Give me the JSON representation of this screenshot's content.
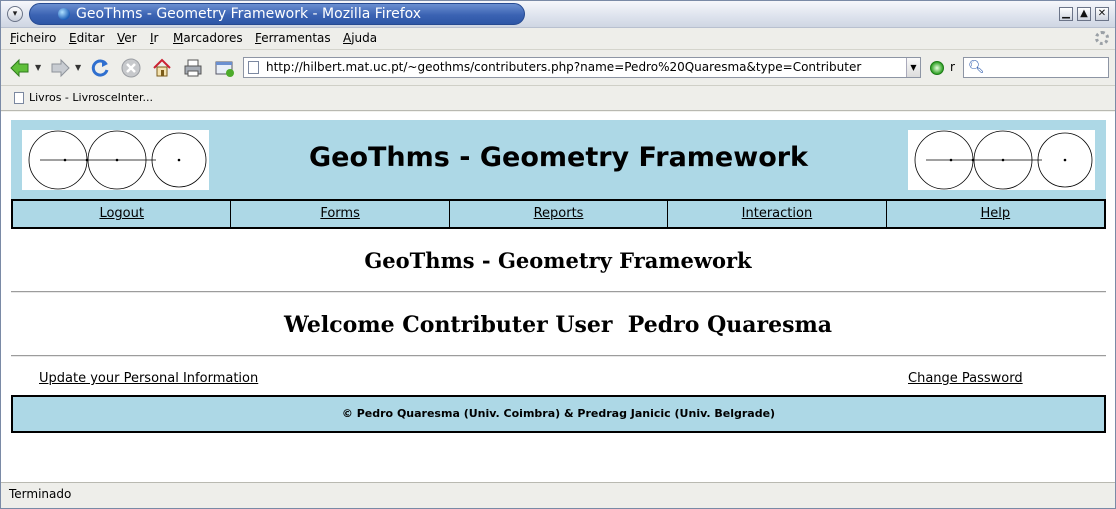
{
  "window": {
    "title": "GeoThms - Geometry Framework - Mozilla Firefox",
    "menu_glyph": "▾",
    "minimize": "▁",
    "maximize": "▲",
    "close": "✕"
  },
  "menubar": {
    "items": [
      "Ficheiro",
      "Editar",
      "Ver",
      "Ir",
      "Marcadores",
      "Ferramentas",
      "Ajuda"
    ]
  },
  "toolbar": {
    "url": "http://hilbert.mat.uc.pt/~geothms/contributers.php?name=Pedro%20Quaresma&type=Contributer",
    "go_label": "r",
    "search_value": ""
  },
  "bookmarks": {
    "items": [
      "Livros - LivrosceInter..."
    ]
  },
  "header": {
    "title": "GeoThms - Geometry Framework"
  },
  "nav": {
    "items": [
      "Logout",
      "Forms",
      "Reports",
      "Interaction",
      "Help"
    ]
  },
  "main": {
    "heading": "GeoThms - Geometry Framework",
    "welcome": "Welcome Contributer User  Pedro Quaresma",
    "update_link": "Update your Personal Information",
    "password_link": "Change Password"
  },
  "footer": {
    "text": "© Pedro Quaresma (Univ. Coimbra) & Predrag Janicic (Univ. Belgrade)"
  },
  "status": {
    "text": "Terminado"
  },
  "colors": {
    "band": "#add8e6",
    "titlebar_accent": "#3b63b3"
  }
}
